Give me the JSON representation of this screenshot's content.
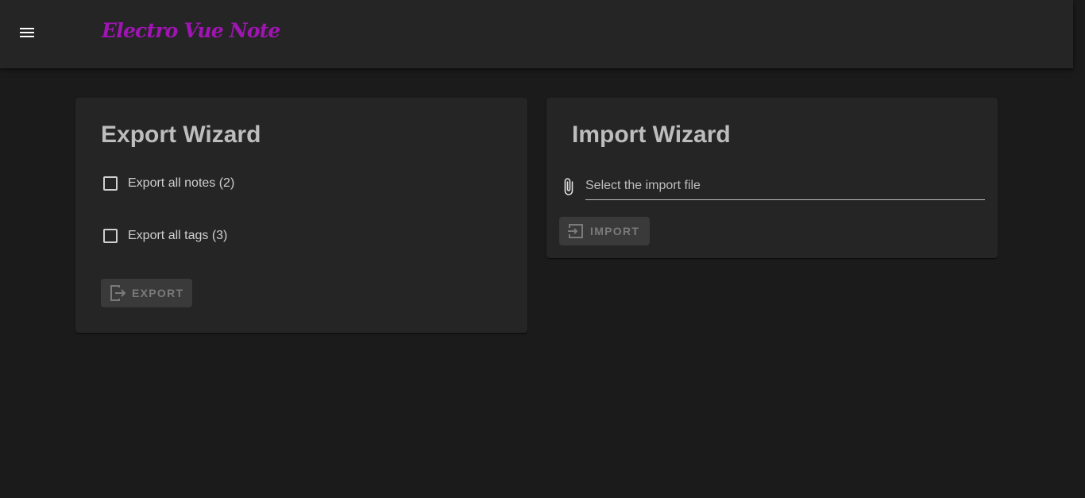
{
  "app_bar": {
    "title": "Electro Vue Note",
    "title_color": "#a114b4",
    "menu_icon": "menu-icon"
  },
  "export_wizard": {
    "title": "Export Wizard",
    "options": [
      {
        "label": "Export all notes (2)",
        "checked": false
      },
      {
        "label": "Export all tags (3)",
        "checked": false
      }
    ],
    "button_label": "EXPORT",
    "button_icon": "export-icon",
    "button_disabled": true
  },
  "import_wizard": {
    "title": "Import Wizard",
    "file_icon": "paperclip-icon",
    "file_placeholder": "Select the import file",
    "button_label": "IMPORT",
    "button_icon": "import-icon",
    "button_disabled": true
  }
}
